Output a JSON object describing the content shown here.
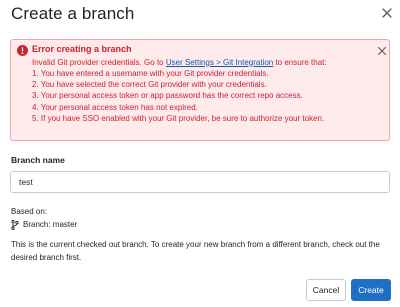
{
  "dialog": {
    "title": "Create a branch",
    "close_icon": "close-icon"
  },
  "error": {
    "icon": "error-circle-icon",
    "title": "Error creating a branch",
    "intro_prefix": "Invalid Git provider credentials. Go to ",
    "link_text": "User Settings > Git Integration",
    "intro_suffix": " to ensure that:",
    "items": [
      "1. You have entered a username with your Git provider credentials.",
      "2. You have selected the correct Git provider with your credentials.",
      "3. Your personal access token or app password has the correct repo access.",
      "4. Your personal access token has not expired.",
      "5. If you have SSO enabled with your Git provider, be sure to authorize your token."
    ],
    "colors": {
      "background": "#ffeaec",
      "border": "#f0a4aa",
      "text": "#c9242f"
    }
  },
  "form": {
    "branch_name_label": "Branch name",
    "branch_name_value": "test",
    "based_on_label": "Based on:",
    "branch_icon": "git-branch-icon",
    "based_on_branch": "Branch: master",
    "help_text": "This is the current checked out branch. To create your new branch from a different branch, check out the desired branch first."
  },
  "buttons": {
    "cancel": "Cancel",
    "create": "Create",
    "primary_color": "#1f6fc5"
  }
}
